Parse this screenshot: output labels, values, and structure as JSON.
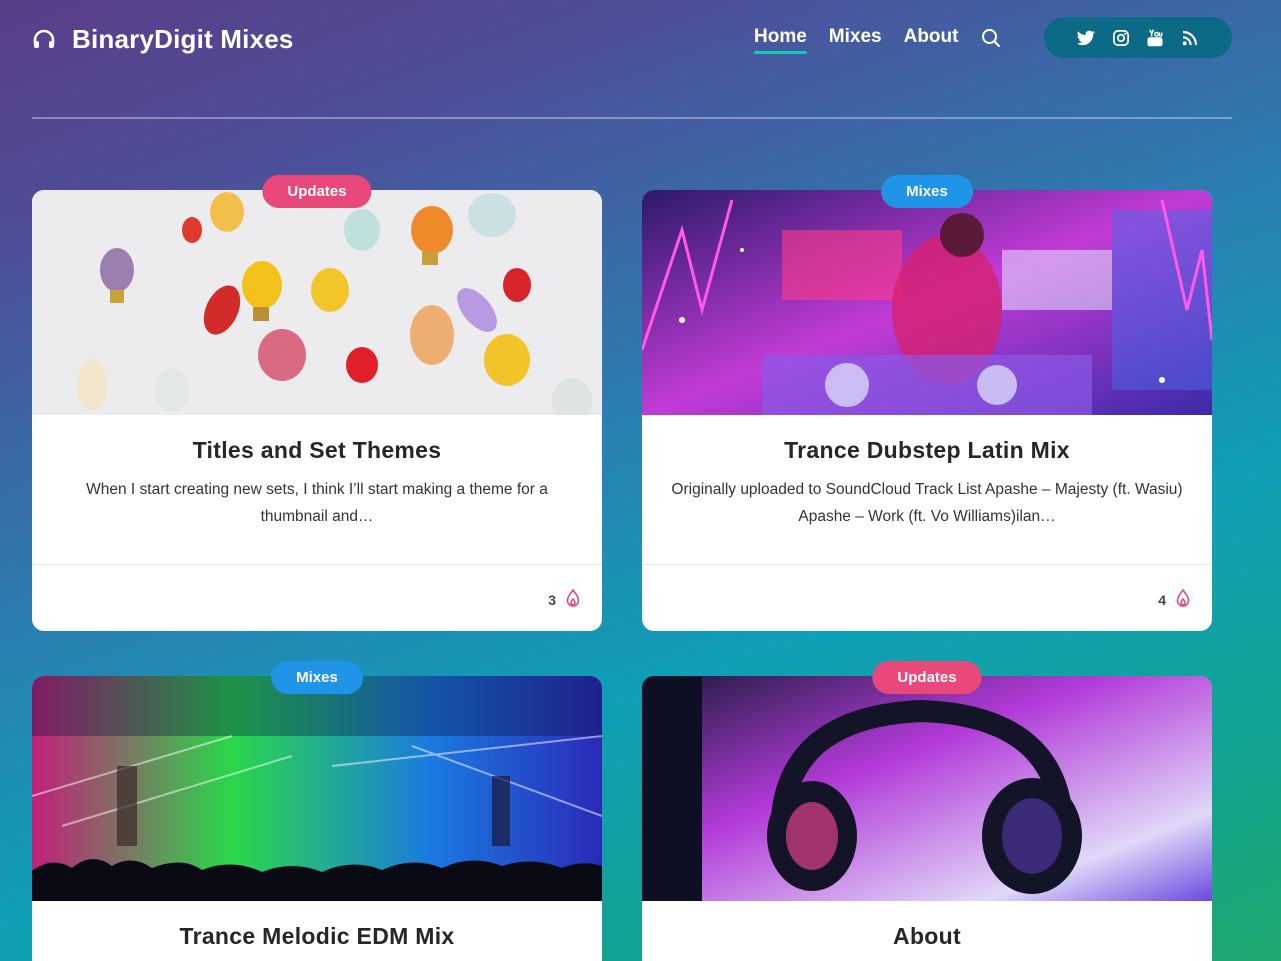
{
  "site": {
    "title": "BinaryDigit Mixes",
    "logo_icon": "headphones-icon"
  },
  "nav": {
    "items": [
      {
        "label": "Home",
        "active": true
      },
      {
        "label": "Mixes",
        "active": false
      },
      {
        "label": "About",
        "active": false
      }
    ],
    "search_icon": "search-icon"
  },
  "social": [
    "twitter-icon",
    "instagram-icon",
    "youtube-icon",
    "rss-icon"
  ],
  "colors": {
    "accent_underline": "#14c9b0",
    "badge_updates": "#e8487a",
    "badge_mixes": "#2094e6",
    "like_icon": "#e8487a"
  },
  "posts": [
    {
      "category": "Updates",
      "title": "Titles and Set Themes",
      "excerpt": "When I start creating new sets, I think I’ll start making a theme for a thumbnail and…",
      "likes": "3",
      "image": "light-bulbs-image"
    },
    {
      "category": "Mixes",
      "title": "Trance Dubstep Latin Mix",
      "excerpt": "Originally uploaded to SoundCloud Track List Apashe – Majesty (ft. Wasiu) Apashe – Work (ft. Vo Williams)ilan…",
      "likes": "4",
      "image": "dj-neon-image"
    },
    {
      "category": "Mixes",
      "title": "Trance Melodic EDM Mix",
      "image": "concert-lights-image"
    },
    {
      "category": "Updates",
      "title": "About",
      "image": "headphones-photo-image"
    }
  ]
}
